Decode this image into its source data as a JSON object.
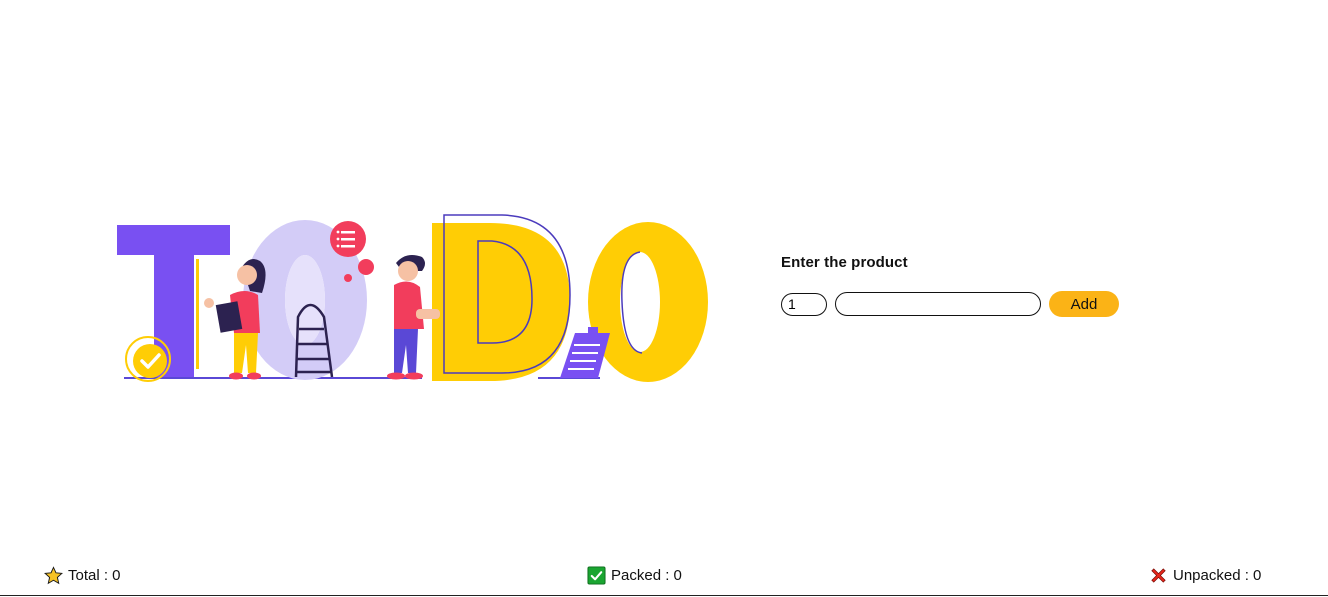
{
  "form": {
    "title": "Enter the product",
    "quantity_value": "1",
    "product_value": "",
    "add_label": "Add"
  },
  "stats": {
    "total_label": "Total : 0",
    "packed_label": "Packed : 0",
    "unpacked_label": "Unpacked : 0"
  },
  "icons": {
    "total": "star-icon",
    "packed": "checkbox-checked-icon",
    "unpacked": "red-cross-icon",
    "hero": "todo-illustration"
  },
  "colors": {
    "accent": "#fbb316",
    "purple": "#7950f2",
    "lavender": "#d3ccf7",
    "yellow": "#ffcd05",
    "pink": "#f23d5c",
    "check_green": "#1aa531",
    "cross_red": "#e8261b"
  }
}
